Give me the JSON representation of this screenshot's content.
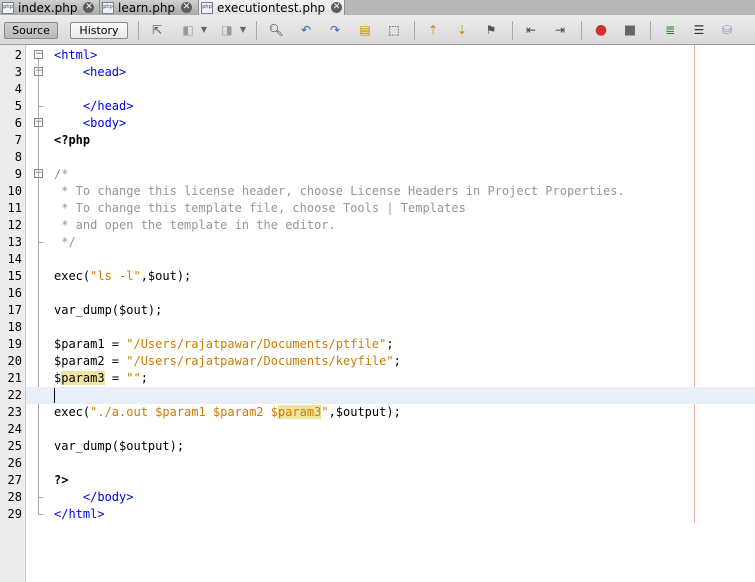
{
  "tabs": [
    {
      "label": "index.php",
      "active": false
    },
    {
      "label": "learn.php",
      "active": false
    },
    {
      "label": "executiontest.php",
      "active": true
    }
  ],
  "toolbar": {
    "source_label": "Source",
    "history_label": "History",
    "icons": [
      "back-icon",
      "forward-icon",
      "toggle-bookmark-icon",
      "find-icon",
      "find-previous-icon",
      "find-next-icon",
      "toggle-highlight-icon",
      "find-selection-icon",
      "previous-bookmark-icon",
      "next-bookmark-icon",
      "toggle-bookmark-icon",
      "shift-left-icon",
      "shift-right-icon",
      "start-macro-icon",
      "stop-macro-icon",
      "comment-icon",
      "uncomment-icon",
      "database-icon"
    ]
  },
  "editor": {
    "current_line": 22,
    "lines": [
      {
        "n": "2",
        "text": "<html>"
      },
      {
        "n": "3",
        "text": "    <head>"
      },
      {
        "n": "4",
        "text": ""
      },
      {
        "n": "5",
        "text": "    </head>"
      },
      {
        "n": "6",
        "text": "    <body>"
      },
      {
        "n": "7",
        "text": "<?php"
      },
      {
        "n": "8",
        "text": ""
      },
      {
        "n": "9",
        "text": "/*"
      },
      {
        "n": "10",
        "text": " * To change this license header, choose License Headers in Project Properties."
      },
      {
        "n": "11",
        "text": " * To change this template file, choose Tools | Templates"
      },
      {
        "n": "12",
        "text": " * and open the template in the editor."
      },
      {
        "n": "13",
        "text": " */"
      },
      {
        "n": "14",
        "text": ""
      },
      {
        "n": "15",
        "text": "exec(\"ls -l\",$out);"
      },
      {
        "n": "16",
        "text": ""
      },
      {
        "n": "17",
        "text": "var_dump($out);"
      },
      {
        "n": "18",
        "text": ""
      },
      {
        "n": "19",
        "text": "$param1 = \"/Users/rajatpawar/Documents/ptfile\";"
      },
      {
        "n": "20",
        "text": "$param2 = \"/Users/rajatpawar/Documents/keyfile\";"
      },
      {
        "n": "21",
        "text": "$param3 = \"\";"
      },
      {
        "n": "22",
        "text": ""
      },
      {
        "n": "23",
        "text": "exec(\"./a.out $param1 $param2 $param3\",$output);"
      },
      {
        "n": "24",
        "text": ""
      },
      {
        "n": "25",
        "text": "var_dump($output);"
      },
      {
        "n": "26",
        "text": ""
      },
      {
        "n": "27",
        "text": "?>"
      },
      {
        "n": "28",
        "text": "    </body>"
      },
      {
        "n": "29",
        "text": "</html>"
      }
    ]
  },
  "colors": {
    "tag": "#0000e6",
    "string": "#ce7b00",
    "comment": "#969696",
    "highlight": "#eee5a0",
    "current_line": "#e9eff8"
  }
}
